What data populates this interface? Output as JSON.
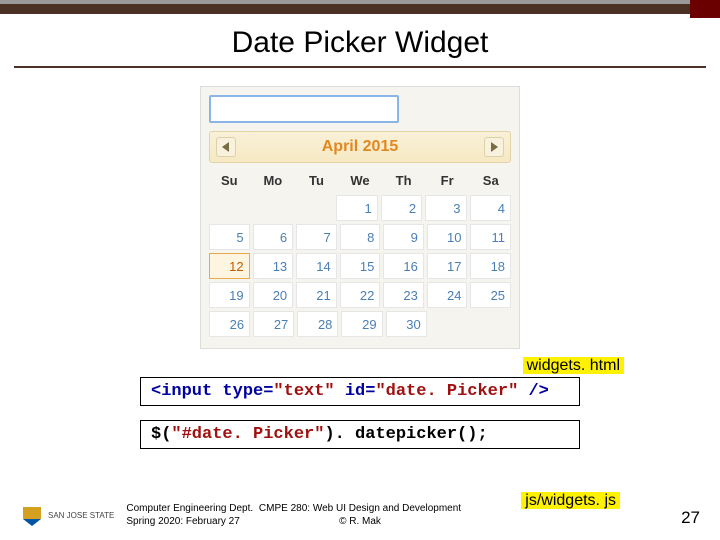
{
  "title": "Date Picker Widget",
  "datepicker": {
    "month": "April 2015",
    "dow": [
      "Su",
      "Mo",
      "Tu",
      "We",
      "Th",
      "Fr",
      "Sa"
    ],
    "weeks": [
      [
        "",
        "",
        "",
        "1",
        "2",
        "3",
        "4"
      ],
      [
        "5",
        "6",
        "7",
        "8",
        "9",
        "10",
        "11"
      ],
      [
        "12",
        "13",
        "14",
        "15",
        "16",
        "17",
        "18"
      ],
      [
        "19",
        "20",
        "21",
        "22",
        "23",
        "24",
        "25"
      ],
      [
        "26",
        "27",
        "28",
        "29",
        "30",
        "",
        ""
      ]
    ],
    "selected": "12"
  },
  "file1": "widgets. html",
  "code1_pre": "<input type=",
  "code1_qtext": "\"text\"",
  "code1_mid": " id=",
  "code1_qid": "\"date. Picker\"",
  "code1_suf": " />",
  "code2_pre": "$(",
  "code2_str": "\"#date. Picker\"",
  "code2_suf": "). datepicker();",
  "file2": "js/widgets. js",
  "logo_text": "SAN JOSE STATE",
  "footer_left1": "Computer Engineering Dept.",
  "footer_left2": "Spring 2020: February 27",
  "footer_center1": "CMPE 280: Web UI Design and Development",
  "footer_center2": "© R. Mak",
  "page": "27"
}
